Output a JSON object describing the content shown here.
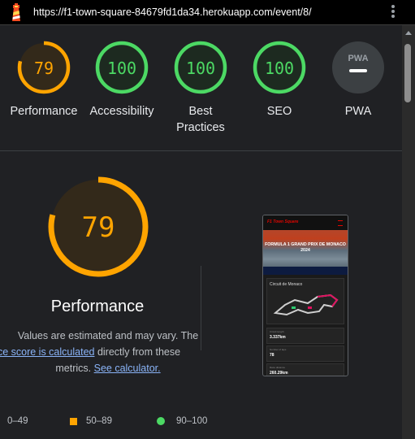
{
  "topbar": {
    "url": "https://f1-town-square-84679fd1da34.herokuapp.com/event/8/",
    "logo": "lighthouse-icon",
    "menu_icon": "kebab-menu-icon"
  },
  "gauges": [
    {
      "score": "79",
      "label": "Performance",
      "fraction": 0.79,
      "color": "#ffa400"
    },
    {
      "score": "100",
      "label": "Accessibility",
      "fraction": 1.0,
      "color": "#4cd964"
    },
    {
      "score": "100",
      "label_line1": "Best",
      "label_line2": "Practices",
      "fraction": 1.0,
      "color": "#4cd964"
    },
    {
      "score": "100",
      "label": "SEO",
      "fraction": 1.0,
      "color": "#4cd964"
    },
    {
      "badge": "PWA",
      "label": "PWA",
      "color": "#9aa0a6"
    }
  ],
  "main": {
    "score": "79",
    "fraction": 0.79,
    "title": "Performance",
    "note_line1": "Values are estimated and may vary. The",
    "note_link1": "performance score is calculated",
    "note_mid": " directly from these",
    "note_line3": "metrics.",
    "note_link2": "See calculator."
  },
  "legend": [
    {
      "range": "0–49",
      "color": "#ff4e42"
    },
    {
      "range": "50–89",
      "color": "#ffa400"
    },
    {
      "range": "90–100",
      "color": "#4cd964"
    }
  ],
  "thumbnail": {
    "brand": "F1 Town Square",
    "hero_title": "FORMULA 1 GRAND PRIX DE MONACO 2024",
    "circuit": "Circuit de Monaco",
    "stats": [
      {
        "label": "Circuit length",
        "value": "3.337km"
      },
      {
        "label": "Number of laps",
        "value": "78"
      },
      {
        "label": "Race distance",
        "value": "260.29km"
      }
    ]
  }
}
